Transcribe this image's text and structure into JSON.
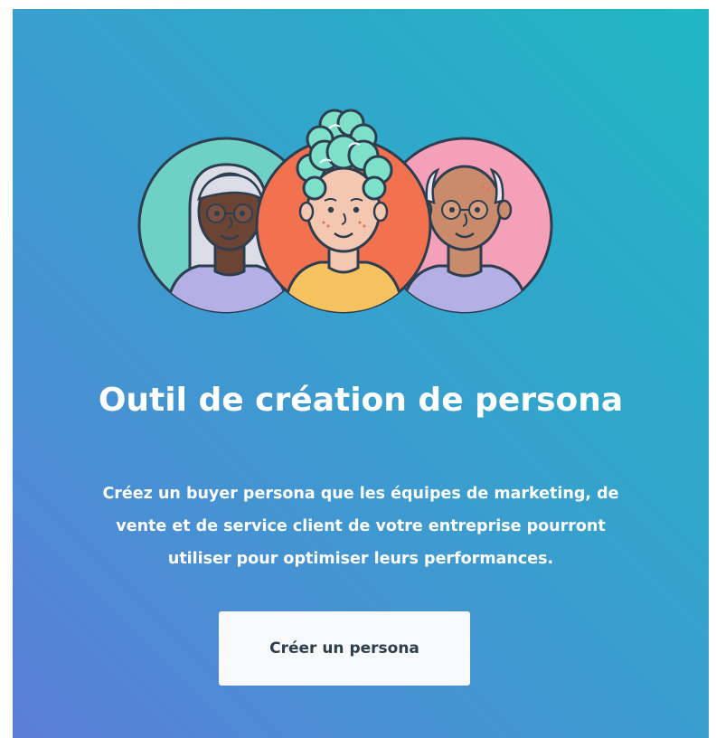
{
  "hero": {
    "title": "Outil de création de persona",
    "description_lines": [
      "Créez un buyer persona que les équipes de marketing, de",
      "vente et de service client de votre entreprise pourront",
      "utiliser pour optimiser leurs performances."
    ],
    "cta_label": "Créer un persona"
  },
  "colors": {
    "gradient_top_right": "#1fb7c3",
    "gradient_bottom_left": "#5b7dd6",
    "avatar_left_bg": "#6fd1c5",
    "avatar_center_bg": "#f2714e",
    "avatar_right_bg": "#f4a0b8",
    "outline": "#2d3e50",
    "button_bg": "#f7f9fb",
    "button_text": "#2d3e50"
  },
  "illustration": {
    "icons": [
      "persona-woman-gray-hair-icon",
      "persona-woman-curly-hair-icon",
      "persona-man-bald-icon"
    ]
  }
}
